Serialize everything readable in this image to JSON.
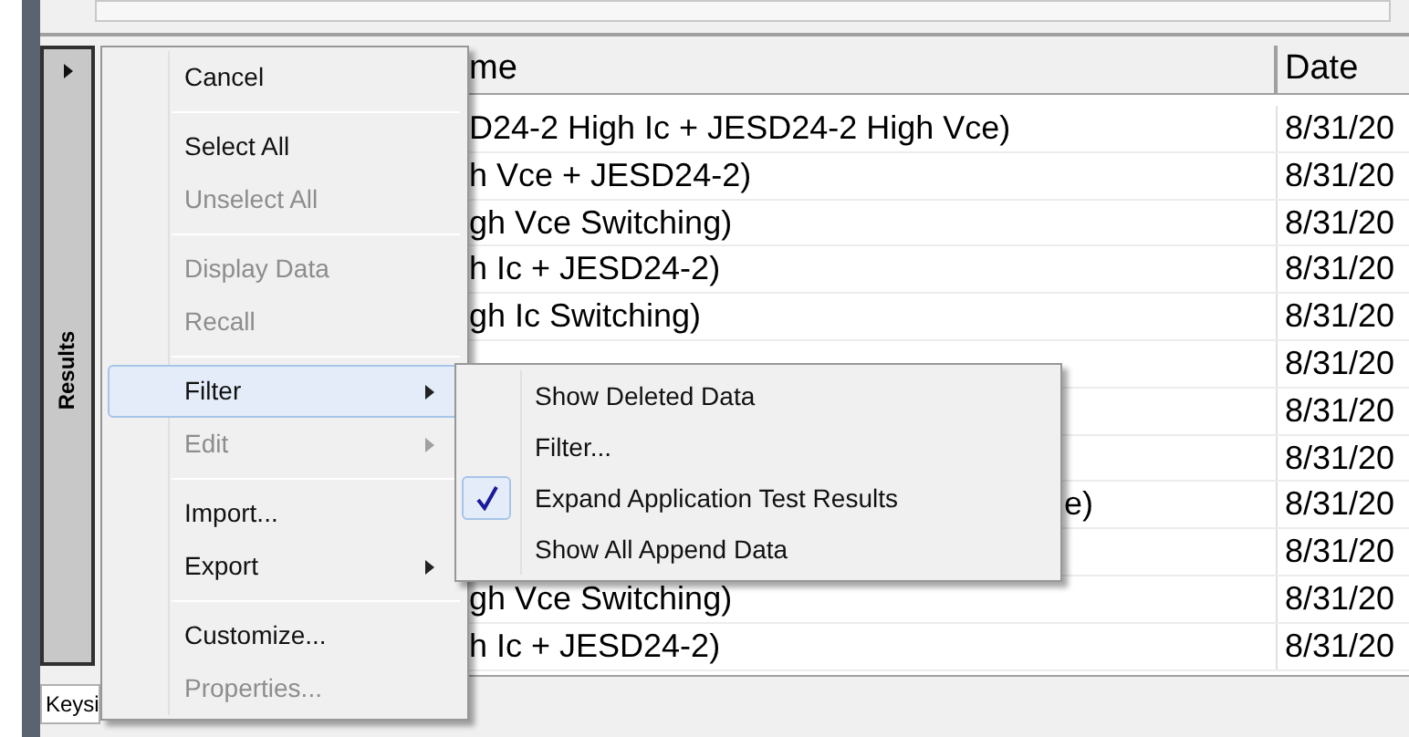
{
  "side_panel": {
    "tab_label": "Results"
  },
  "bottom_tab": {
    "label": "Keysi"
  },
  "table": {
    "columns": [
      "me",
      "Date"
    ],
    "rows": [
      {
        "name": "D24-2 High Ic + JESD24-2 High Vce)",
        "date": "8/31/20"
      },
      {
        "name": "h Vce + JESD24-2)",
        "date": "8/31/20"
      },
      {
        "name": "gh Vce Switching)",
        "date": "8/31/20"
      },
      {
        "name": "h Ic + JESD24-2)",
        "date": "8/31/20"
      },
      {
        "name": "gh Ic Switching)",
        "date": "8/31/20"
      },
      {
        "date": "8/31/20"
      },
      {
        "date": "8/31/20"
      },
      {
        "date": "8/31/20"
      },
      {
        "name_tail": "e)",
        "date": "8/31/20"
      },
      {
        "date": "8/31/20"
      },
      {
        "name": "gh Vce Switching)",
        "date": "8/31/20"
      },
      {
        "name": "h Ic + JESD24-2)",
        "date": "8/31/20"
      }
    ]
  },
  "context_menu": {
    "items": [
      {
        "kind": "item",
        "label": "Cancel",
        "disabled": false,
        "submenu": false,
        "highlighted": false
      },
      {
        "kind": "separator"
      },
      {
        "kind": "item",
        "label": "Select All",
        "disabled": false,
        "submenu": false,
        "highlighted": false
      },
      {
        "kind": "item",
        "label": "Unselect All",
        "disabled": true,
        "submenu": false,
        "highlighted": false
      },
      {
        "kind": "separator"
      },
      {
        "kind": "item",
        "label": "Display Data",
        "disabled": true,
        "submenu": false,
        "highlighted": false
      },
      {
        "kind": "item",
        "label": "Recall",
        "disabled": true,
        "submenu": false,
        "highlighted": false
      },
      {
        "kind": "separator"
      },
      {
        "kind": "item",
        "label": "Filter",
        "disabled": false,
        "submenu": true,
        "highlighted": true
      },
      {
        "kind": "item",
        "label": "Edit",
        "disabled": true,
        "submenu": true,
        "highlighted": false
      },
      {
        "kind": "separator"
      },
      {
        "kind": "item",
        "label": "Import...",
        "disabled": false,
        "submenu": false,
        "highlighted": false
      },
      {
        "kind": "item",
        "label": "Export",
        "disabled": false,
        "submenu": true,
        "highlighted": false
      },
      {
        "kind": "separator"
      },
      {
        "kind": "item",
        "label": "Customize...",
        "disabled": false,
        "submenu": false,
        "highlighted": false
      },
      {
        "kind": "item",
        "label": "Properties...",
        "disabled": true,
        "submenu": false,
        "highlighted": false
      }
    ]
  },
  "submenu": {
    "items": [
      {
        "label": "Show Deleted Data",
        "checked": false
      },
      {
        "label": "Filter...",
        "checked": false
      },
      {
        "label": "Expand Application Test Results",
        "checked": true
      },
      {
        "label": "Show All Append Data",
        "checked": false
      }
    ]
  }
}
